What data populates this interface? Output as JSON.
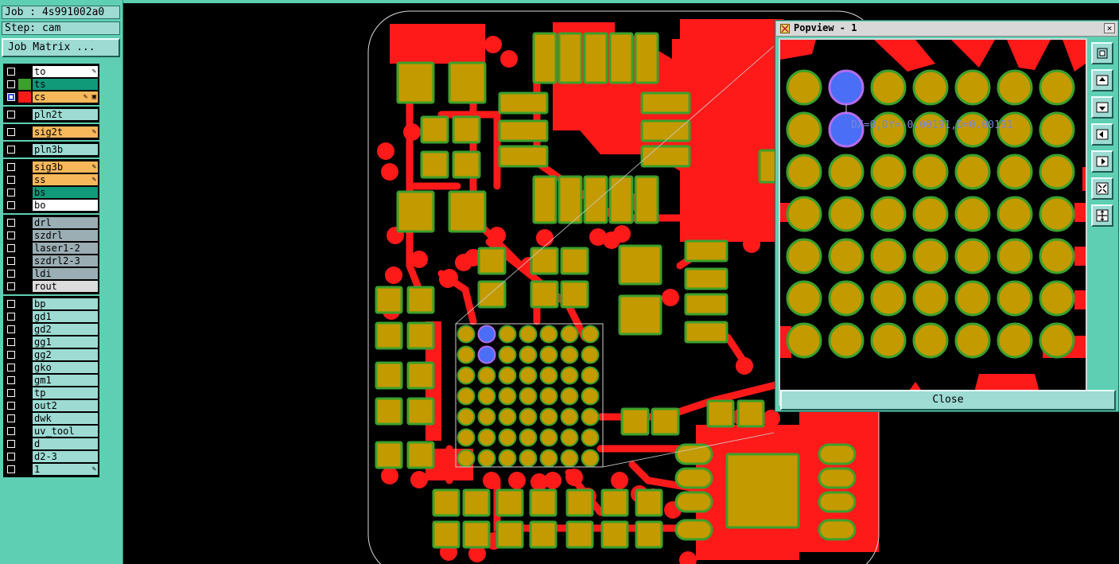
{
  "job_label": "Job : 4s991002a0",
  "step_label": "Step: cam",
  "job_matrix_button": "Job Matrix ...",
  "layer_groups": [
    [
      {
        "name": "to",
        "color": "#ffffff",
        "swatch": "#000000",
        "flag": "✎",
        "checked": false
      },
      {
        "name": "ts",
        "color": "#109a7a",
        "swatch": "#3ca02c",
        "flag": "",
        "checked": false
      },
      {
        "name": "cs",
        "color": "#f7b85c",
        "swatch": "#ff1a1a",
        "flag": "✎ ▣",
        "checked": true
      }
    ],
    [
      {
        "name": "pln2t",
        "color": "#9ddbd3",
        "swatch": "#000000",
        "flag": "",
        "checked": false
      }
    ],
    [
      {
        "name": "sig2t",
        "color": "#f7b85c",
        "swatch": "#000000",
        "flag": "✎",
        "checked": false
      }
    ],
    [
      {
        "name": "pln3b",
        "color": "#9ddbd3",
        "swatch": "#000000",
        "flag": "",
        "checked": false
      }
    ],
    [
      {
        "name": "sig3b",
        "color": "#f7b85c",
        "swatch": "#000000",
        "flag": "✎",
        "checked": false
      },
      {
        "name": "ss",
        "color": "#f7b85c",
        "swatch": "#000000",
        "flag": "✎",
        "checked": false
      },
      {
        "name": "bs",
        "color": "#109a7a",
        "swatch": "#000000",
        "flag": "",
        "checked": false
      },
      {
        "name": "bo",
        "color": "#ffffff",
        "swatch": "#000000",
        "flag": "",
        "checked": false
      }
    ],
    [
      {
        "name": "drl",
        "color": "#9aaeb4",
        "swatch": "#000000",
        "flag": "",
        "checked": false
      },
      {
        "name": "szdrl",
        "color": "#9aaeb4",
        "swatch": "#000000",
        "flag": "",
        "checked": false
      },
      {
        "name": "laser1-2",
        "color": "#9aaeb4",
        "swatch": "#000000",
        "flag": "",
        "checked": false
      },
      {
        "name": "szdrl2-3",
        "color": "#9aaeb4",
        "swatch": "#000000",
        "flag": "",
        "checked": false
      },
      {
        "name": "ldi",
        "color": "#9aaeb4",
        "swatch": "#000000",
        "flag": "",
        "checked": false
      },
      {
        "name": "rout",
        "color": "#dcdcdc",
        "swatch": "#000000",
        "flag": "",
        "checked": false
      }
    ],
    [
      {
        "name": "bp",
        "color": "#9ddbd3",
        "swatch": "#000000",
        "flag": "",
        "checked": false
      },
      {
        "name": "gd1",
        "color": "#9ddbd3",
        "swatch": "#000000",
        "flag": "",
        "checked": false
      },
      {
        "name": "gd2",
        "color": "#9ddbd3",
        "swatch": "#000000",
        "flag": "",
        "checked": false
      },
      {
        "name": "gg1",
        "color": "#9ddbd3",
        "swatch": "#000000",
        "flag": "",
        "checked": false
      },
      {
        "name": "gg2",
        "color": "#9ddbd3",
        "swatch": "#000000",
        "flag": "",
        "checked": false
      },
      {
        "name": "gko",
        "color": "#9ddbd3",
        "swatch": "#000000",
        "flag": "",
        "checked": false
      },
      {
        "name": "gm1",
        "color": "#9ddbd3",
        "swatch": "#000000",
        "flag": "",
        "checked": false
      },
      {
        "name": "tp",
        "color": "#9ddbd3",
        "swatch": "#000000",
        "flag": "",
        "checked": false
      },
      {
        "name": "out2",
        "color": "#9ddbd3",
        "swatch": "#000000",
        "flag": "",
        "checked": false
      },
      {
        "name": "dwk",
        "color": "#9ddbd3",
        "swatch": "#000000",
        "flag": "",
        "checked": false
      },
      {
        "name": "uv_tool",
        "color": "#9ddbd3",
        "swatch": "#000000",
        "flag": "",
        "checked": false
      },
      {
        "name": "d",
        "color": "#9ddbd3",
        "swatch": "#000000",
        "flag": "",
        "checked": false
      },
      {
        "name": "d2-3",
        "color": "#9ddbd3",
        "swatch": "#000000",
        "flag": "",
        "checked": false
      },
      {
        "name": "1",
        "color": "#9ddbd3",
        "swatch": "#000000",
        "flag": "✎",
        "checked": false
      }
    ]
  ],
  "popview": {
    "title": "Popview - 1",
    "close_x": "×",
    "measure_text": "DX=0,DY=-0.00191,D=0.00191",
    "close_button": "Close",
    "tools": [
      "fit-icon",
      "pan-up-icon",
      "pan-down-icon",
      "pan-left-icon",
      "pan-right-icon",
      "zoom-in-icon",
      "zoom-out-icon"
    ]
  },
  "colors": {
    "panel": "#5ecfb2",
    "copper": "#ff1a1a",
    "pad": "#c39a00",
    "pad_outline": "#3ca02c",
    "selected": "#4a6ef5",
    "selected_outline": "#b26cf0",
    "background": "#000000"
  }
}
